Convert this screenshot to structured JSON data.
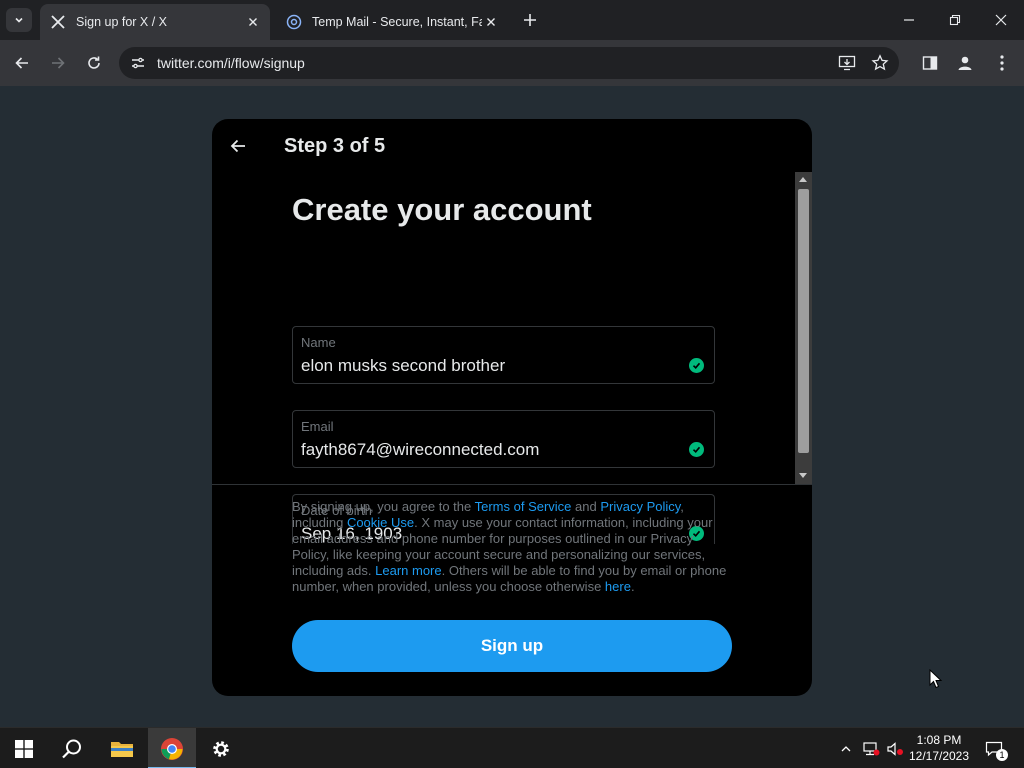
{
  "browser": {
    "tabs": [
      {
        "title": "Sign up for X / X",
        "active": true,
        "favicon": "x-logo-icon"
      },
      {
        "title": "Temp Mail - Secure, Instant, Fast",
        "active": false,
        "favicon": "at-sign-icon"
      }
    ],
    "url": "twitter.com/i/flow/signup"
  },
  "modal": {
    "step": "Step 3 of 5",
    "heading": "Create your account",
    "fields": {
      "name": {
        "label": "Name",
        "value": "elon musks second brother"
      },
      "email": {
        "label": "Email",
        "value": "fayth8674@wireconnected.com"
      },
      "dob": {
        "label": "Date of birth",
        "value": "Sep 16, 1903"
      }
    },
    "legal": {
      "t1": "By signing up, you agree to the ",
      "terms": "Terms of Service",
      "t2": " and ",
      "privacy": "Privacy Policy",
      "t3": ", including ",
      "cookie": "Cookie Use",
      "t4": ". X may use your contact information, including your email address and phone number for purposes outlined in our Privacy Policy, like keeping your account secure and personalizing our services, including ads. ",
      "learn": "Learn more",
      "t5": ". Others will be able to find you by email or phone number, when provided, unless you choose otherwise ",
      "here": "here",
      "t6": "."
    },
    "signup_label": "Sign up"
  },
  "taskbar": {
    "time": "1:08 PM",
    "date": "12/17/2023",
    "notification_count": "1"
  },
  "colors": {
    "accent": "#1d9bf0",
    "check": "#00ba7c",
    "modal_bg": "#000000",
    "page_bg": "#242d34"
  }
}
